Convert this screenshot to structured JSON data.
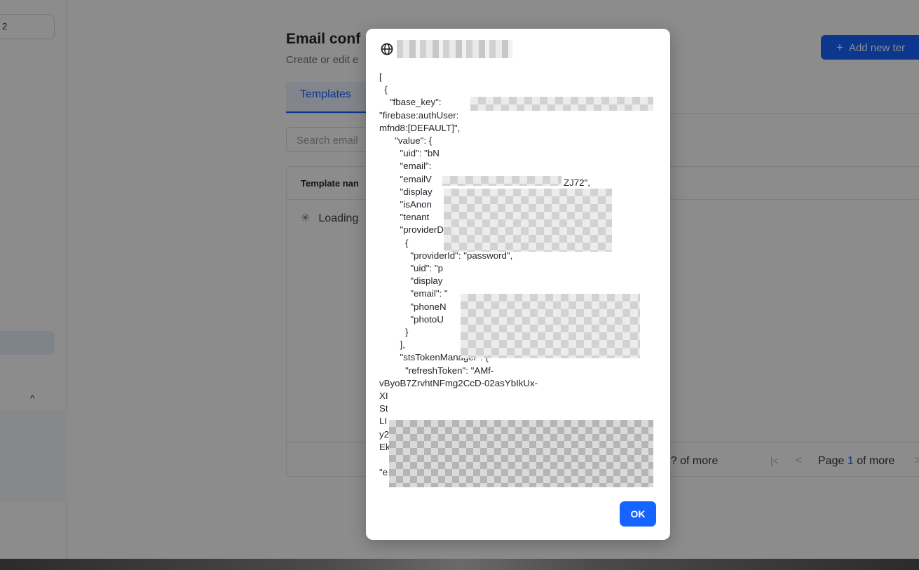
{
  "sidebar": {
    "select_value": "2",
    "chevron": "^"
  },
  "header": {
    "title": "Email conf",
    "subtitle": "Create or edit e",
    "add_button_label": "Add new ter"
  },
  "tabs": [
    {
      "label": "Templates"
    }
  ],
  "search": {
    "placeholder": "Search email"
  },
  "table": {
    "columns": [
      "Template nan"
    ],
    "loading_text": "Loading",
    "pager": {
      "range_text": "to ? of more",
      "page_label": "Page",
      "page_number": "1",
      "page_suffix": "of more"
    }
  },
  "dialog": {
    "icon": "globe-icon",
    "body_lines": [
      "[",
      "  {",
      "    \"fbase_key\":",
      "\"firebase:authUser:",
      "mfnd8:[DEFAULT]\",",
      "      \"value\": {",
      "        \"uid\": \"bN",
      "        \"email\":",
      "        \"emailV",
      "        \"display",
      "        \"isAnon",
      "        \"tenant",
      "        \"providerData\": [",
      "          {",
      "            \"providerId\": \"password\",",
      "            \"uid\": \"p",
      "            \"display",
      "            \"email\": \"",
      "            \"phoneN",
      "            \"photoU",
      "          }",
      "        ],",
      "        \"stsTokenManager\": {",
      "          \"refreshToken\": \"AMf-",
      "vByoB7ZrvhtNFmg2CcD-02asYbIkUx-",
      "XI",
      "St",
      "LI",
      "y2",
      "Ek",
      "",
      "\"e"
    ],
    "uid_tail": "ZJ72\",",
    "ok_label": "OK"
  }
}
